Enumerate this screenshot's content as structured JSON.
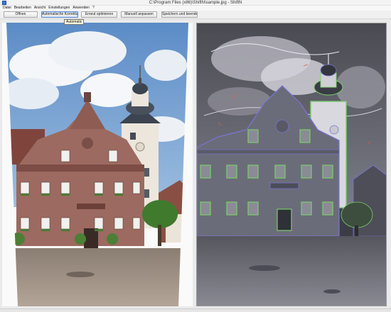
{
  "window": {
    "title": "C:\\Program Files (x86)\\ShiftN\\sample.jpg - ShiftN"
  },
  "menu": {
    "items": [
      "Datei",
      "Bearbeiten",
      "Ansicht",
      "Einstellungen",
      "Anwenden",
      "?"
    ]
  },
  "toolbar": {
    "buttons": [
      "Öffnen",
      "Automatische Korrektur",
      "Erneut optimieren",
      "Manuell anpassen",
      "Speichern und beenden"
    ]
  },
  "tooltip": {
    "text": "Automatic"
  },
  "images": {
    "left": {
      "description_icon": "image-original"
    },
    "right": {
      "description_icon": "image-edge-detected"
    }
  },
  "colors": {
    "toolbar_bg": "#f0f0f0",
    "edge_line": "#7ad06a",
    "edge_blue": "#7a74d8",
    "sky": "#6f9bd0",
    "facade": "#9c6a60"
  }
}
